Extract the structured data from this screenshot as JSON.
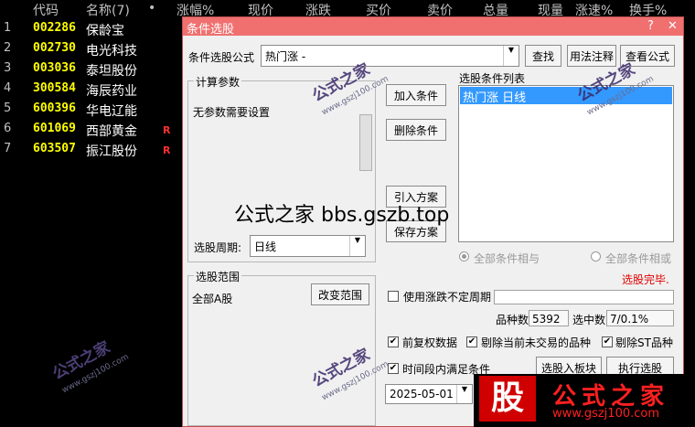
{
  "table": {
    "headers": {
      "idx": "",
      "code": "代码",
      "name": "名称(7)",
      "dot": "•",
      "zhangfu": "涨幅%",
      "xianjia": "现价",
      "zhangdie": "涨跌",
      "mairu": "买价",
      "maichu": "卖价",
      "zongliang": "总量",
      "xianliang": "现量",
      "zhangsu": "涨速%",
      "huanshou": "换手%"
    },
    "rows": [
      {
        "num": "1",
        "code": "002286",
        "name": "保龄宝",
        "flag": ""
      },
      {
        "num": "2",
        "code": "002730",
        "name": "电光科技",
        "flag": ""
      },
      {
        "num": "3",
        "code": "003036",
        "name": "泰坦股份",
        "flag": ""
      },
      {
        "num": "4",
        "code": "300584",
        "name": "海辰药业",
        "flag": ""
      },
      {
        "num": "5",
        "code": "600396",
        "name": "华电辽能",
        "flag": ""
      },
      {
        "num": "6",
        "code": "601069",
        "name": "西部黄金",
        "flag": "R"
      },
      {
        "num": "7",
        "code": "603507",
        "name": "振江股份",
        "flag": "R"
      }
    ]
  },
  "dialog": {
    "title": "条件选股",
    "help_btn": "?",
    "close_btn": "✕",
    "formula_label": "条件选股公式",
    "formula_value": "热门涨    -",
    "find_btn": "查找",
    "usage_btn": "用法注释",
    "view_btn": "查看公式",
    "params_group": "计算参数",
    "params_text": "无参数需要设置",
    "add_btn": "加入条件",
    "delete_btn": "删除条件",
    "import_btn": "引入方案",
    "save_btn": "保存方案",
    "list_title": "选股条件列表",
    "list_item": "热门涨  日线",
    "period_label": "选股周期:",
    "period_value": "日线",
    "radio_and": "全部条件相与",
    "radio_or": "全部条件相或",
    "status": "选股完毕.",
    "range_group": "选股范围",
    "range_value": "全部A股",
    "change_range_btn": "改变范围",
    "uncertain_period": "使用涨跌不定周期",
    "count_label": "品种数",
    "count_value": "5392",
    "selected_label": "选中数",
    "selected_value": "7/0.1%",
    "fq_label": "前复权数据",
    "exclude_label": "剔除当前未交易的品种",
    "st_label": "剔除ST品种",
    "time_label": "时间段内满足条件",
    "to_block_btn": "选股入板块",
    "exec_btn": "执行选股",
    "date_value": "2025-05-01"
  },
  "watermark": {
    "big": "公式之家 bbs.gszb.top",
    "logo_main": "公式之家",
    "logo_url": "www.gszj100.com",
    "logo_char": "股",
    "stamp": "公式之家",
    "stamp_url": "www.gszj100.com"
  },
  "colors": {
    "accent": "#f07070",
    "code": "#ffff00",
    "flag": "#ff3030",
    "selection": "#3399ff"
  }
}
